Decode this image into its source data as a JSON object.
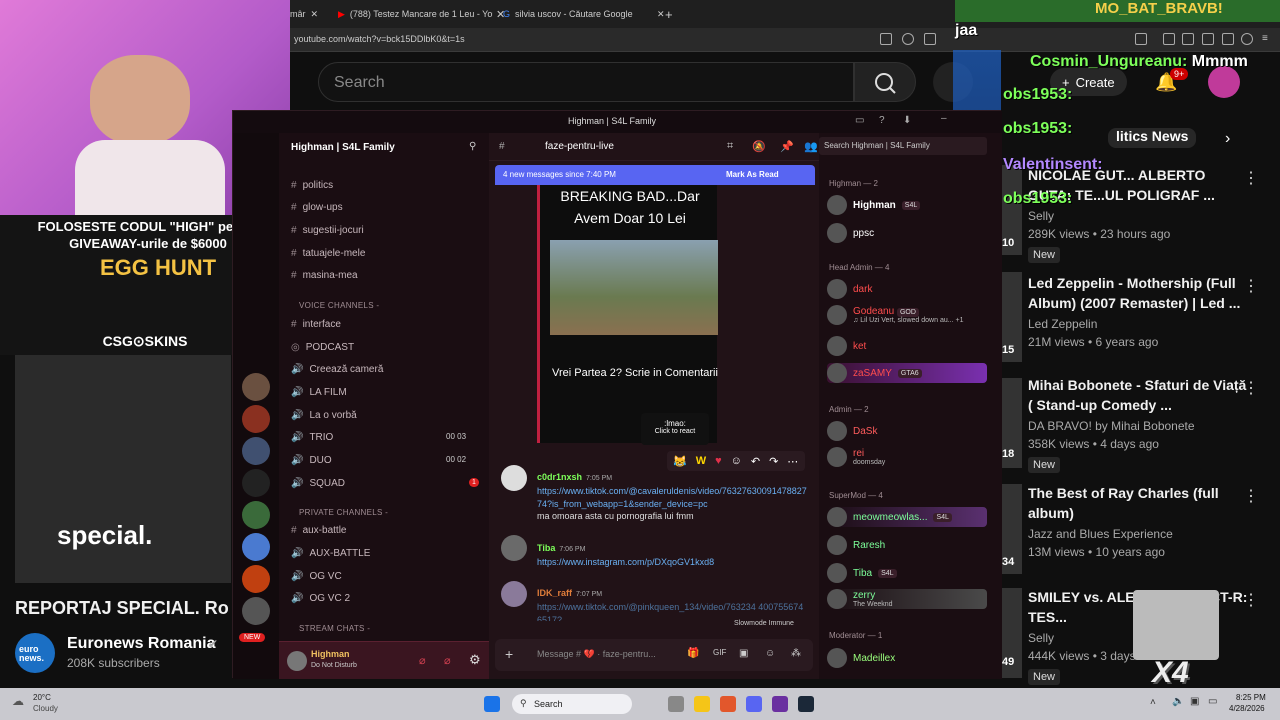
{
  "browser": {
    "tabs": [
      {
        "label": "mâr"
      },
      {
        "label": "(788) Testez Mancare de 1 Leu - You"
      },
      {
        "label": "silvia uscov - Căutare Google"
      }
    ],
    "url": "youtube.com/watch?v=bck15DDlbK0&t=1s"
  },
  "youtube": {
    "search_placeholder": "Search",
    "create_label": "Create",
    "notif_count": "9+",
    "chip_partial": "litics News",
    "main_title": "REPORTAJ SPECIAL. Ro",
    "overlay_word": "special.",
    "channel": {
      "name": "Euronews Romania",
      "subs": "208K subscribers",
      "logo": "euro news."
    },
    "videos": [
      {
        "title": "NICOLAE GUT... ALBERTO GUTA: TE...UL POLIGRAF ...",
        "channel": "Selly",
        "meta": "289K views • 23 hours ago",
        "badge": "New",
        "thumb_num": "10"
      },
      {
        "title": "Led Zeppelin - Mothership (Full Album) (2007 Remaster) | Led ...",
        "channel": "Led Zeppelin",
        "meta": "21M views • 6 years ago",
        "badge": "",
        "thumb_num": "15"
      },
      {
        "title": "Mihai Bobonete - Sfaturi de Viață ( Stand-up Comedy ...",
        "channel": "DA BRAVO! by Mihai Bobonete",
        "meta": "358K views • 4 days ago",
        "badge": "New",
        "thumb_num": "18"
      },
      {
        "title": "The Best of Ray Charles (full album)",
        "channel": "Jazz and Blues Experience",
        "meta": "13M views • 10 years ago",
        "badge": "",
        "thumb_num": "34"
      },
      {
        "title": "SMILEY vs. ALEX... CONNECT-R: TES...",
        "channel": "Selly",
        "meta": "444K views • 3 days...",
        "badge": "New",
        "thumb_num": "49"
      }
    ]
  },
  "stream": {
    "promo": "FOLOSESTE CODUL \"HIGH\" pentru GIVEAWAY-urile de $6000",
    "egg_hunt": "EGG HUNT",
    "sponsor": "CSG⊙SKINS",
    "x4": "X4",
    "chat": [
      {
        "user": "jaa",
        "text": "",
        "color": "#ffffff"
      },
      {
        "user": "Cosmin_Ungureanu:",
        "text": "Mmmm",
        "color": "#7dff5a"
      },
      {
        "user": "obs1953:",
        "text": "",
        "color": "#7dff5a"
      },
      {
        "user": "obs1953:",
        "text": "",
        "color": "#7dff5a"
      },
      {
        "user": "Valentinsent:",
        "text": "",
        "color": "#b388ff"
      },
      {
        "user": "obs1953:",
        "text": "",
        "color": "#7dff5a"
      }
    ],
    "top_text": "MO_BAT_BRAVB!"
  },
  "discord": {
    "window_title": "Highman | S4L Family",
    "server_name": "Highman | S4L Family",
    "channel_name": "faze-pentru-live",
    "search_placeholder": "Search Highman | S4L Family",
    "new_messages": "4 new messages since 7:40 PM",
    "mark_read": "Mark As Read",
    "text_channels": [
      "politics",
      "glow-ups",
      "sugestii-jocuri",
      "tatuajele-mele",
      "masina-mea"
    ],
    "voice_header": "VOICE CHANNELS -",
    "voice_channels": [
      {
        "name": "interface",
        "count": ""
      },
      {
        "name": "PODCAST",
        "count": ""
      },
      {
        "name": "Creează cameră",
        "count": ""
      },
      {
        "name": "LA FILM",
        "count": ""
      },
      {
        "name": "La o vorbă",
        "count": ""
      },
      {
        "name": "TRIO",
        "count": "00  03"
      },
      {
        "name": "DUO",
        "count": "00  02"
      },
      {
        "name": "SQUAD",
        "count": "1"
      }
    ],
    "private_header": "PRIVATE CHANNELS -",
    "private_channels": [
      "aux-battle",
      "AUX-BATTLE",
      "OG VC",
      "OG VC 2"
    ],
    "stream_header": "STREAM CHATS -",
    "user_panel": {
      "name": "Highman",
      "status": "Do Not Disturb"
    },
    "embed": {
      "title": "BREAKING BAD...Dar Avem Doar 10 Lei",
      "caption": "Vrei Partea 2? Scrie in Comentarii"
    },
    "tooltip": {
      "emoji": ":lmao:",
      "hint": "Click to react"
    },
    "messages": [
      {
        "user": "c0dr1nxsh",
        "time": "7:05 PM",
        "link": "https://www.tiktok.com/@cavaleruldenis/video/7632763009147882774?is_from_webapp=1&sender_device=pc",
        "text": "ma omoara asta cu pornografia lui fmm",
        "color": "#7dff5a"
      },
      {
        "user": "Tiba",
        "time": "7:06 PM",
        "link": "https://www.instagram.com/p/DXqoGV1kxd8",
        "text": "",
        "color": "#7dff5a"
      },
      {
        "user": "IDK_raff",
        "time": "7:07 PM",
        "link": "https://www.tiktok.com/@pinkqueen_134/video/763234 4007556746517?",
        "text": "",
        "color": "#e07d3a"
      }
    ],
    "message_placeholder": "Message # 💔 · faze-pentru...",
    "slowmode": "Slowmode Immune",
    "member_groups": [
      {
        "header": "Highman — 2",
        "members": [
          {
            "name": "Highman",
            "tag": "S4L",
            "color": "#ffffff"
          },
          {
            "name": "ppsc",
            "tag": "",
            "color": "#ffffff"
          }
        ]
      },
      {
        "header": "Head Admin — 4",
        "members": [
          {
            "name": "dark",
            "tag": "",
            "color": "#ff4d4d"
          },
          {
            "name": "Godeanu",
            "tag": "GOD",
            "color": "#ff4d4d"
          },
          {
            "name": "ket",
            "tag": "",
            "color": "#ff4d4d"
          },
          {
            "name": "zaSAMY",
            "tag": "GTA6",
            "color": "#ff4d4d"
          }
        ]
      },
      {
        "header": "Admin — 2",
        "members": [
          {
            "name": "DaSk",
            "tag": "",
            "color": "#ff5c5c"
          },
          {
            "name": "rei",
            "tag": "",
            "color": "#ff5c5c"
          }
        ]
      },
      {
        "header": "SuperMod — 4",
        "members": [
          {
            "name": "meowmeowlas...",
            "tag": "S4L",
            "color": "#7dff9a"
          },
          {
            "name": "Raresh",
            "tag": "",
            "color": "#7dff9a"
          },
          {
            "name": "Tiba",
            "tag": "S4L",
            "color": "#7dff9a"
          },
          {
            "name": "zerry",
            "tag": "",
            "color": "#7dff9a"
          }
        ]
      },
      {
        "header": "Moderator — 1",
        "members": [
          {
            "name": "Madeillex",
            "tag": "",
            "color": "#9aff7d"
          }
        ]
      }
    ],
    "member_subtexts": {
      "godeanu": "♫ Lil Uzi Vert, slowed down au...",
      "rei": "doomsday",
      "zerry": "The Weeknd",
      "godeanu_count": "+1"
    }
  },
  "taskbar": {
    "weather_temp": "20°C",
    "weather_desc": "Cloudy",
    "search": "Search",
    "time": "8:25 PM",
    "date": "4/28/2026"
  }
}
